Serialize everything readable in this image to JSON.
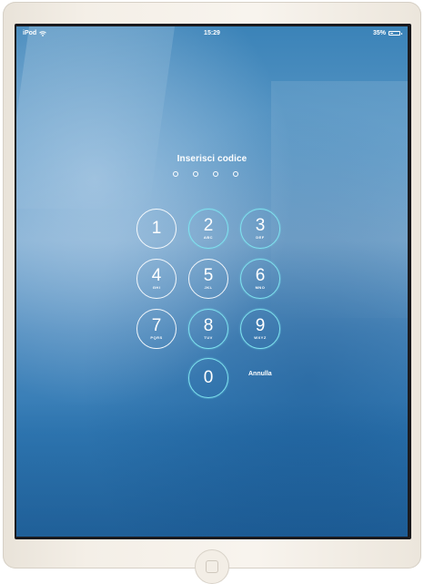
{
  "status_bar": {
    "device": "iPod",
    "time": "15:29",
    "battery_percent_label": "35%",
    "battery_level": 0.35
  },
  "lock_screen": {
    "prompt": "Inserisci codice",
    "passcode_slots": 4,
    "cancel_label": "Annulla"
  },
  "keypad": {
    "keys": [
      {
        "digit": "1",
        "letters": ""
      },
      {
        "digit": "2",
        "letters": "ABC"
      },
      {
        "digit": "3",
        "letters": "DEF"
      },
      {
        "digit": "4",
        "letters": "GHI"
      },
      {
        "digit": "5",
        "letters": "JKL"
      },
      {
        "digit": "6",
        "letters": "MNO"
      },
      {
        "digit": "7",
        "letters": "PQRS"
      },
      {
        "digit": "8",
        "letters": "TUV"
      },
      {
        "digit": "9",
        "letters": "WXYZ"
      },
      {
        "digit": "0",
        "letters": ""
      }
    ]
  },
  "icons": {
    "wifi": "wifi-icon",
    "battery": "battery-icon",
    "home": "home-button-icon"
  },
  "colors": {
    "screen_top": "#3b83b8",
    "screen_bottom": "#2a72ad",
    "key_outline": "#ffffff",
    "key_outline_teal": "#7fe3ef",
    "device_frame": "#f4efe7"
  }
}
